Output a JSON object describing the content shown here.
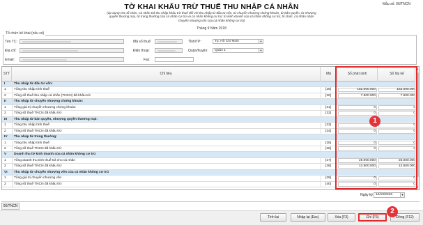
{
  "header": {
    "form_code": "Mẫu số: 06/TNCN",
    "title": "TỜ KHAI KHẤU TRỪ THUẾ THU NHẬP CÁ NHÂN",
    "subtitle": "(áp dụng cho tổ chức, cá nhân trả thu nhập khấu trừ thuế đối với thu nhập từ đầu tư vốn, từ chuyển nhượng chứng khoán, từ bản quyền, từ nhượng quyền thương mại, từ trúng thưởng của cá nhân cư trú và cá nhân không cư trú; từ kinh doanh của cá nhân không cư trú; tổ chức, cá nhân nhận chuyển nhượng vốn của cá nhân không cư trú)",
    "period": "Tháng 9 Năm 2018"
  },
  "org": {
    "section_label": "Tổ chức kê khai (nếu có)",
    "ten_tc_label": "Tên TC:",
    "ma_so_thue_label": "Mã số thuế:",
    "tinh_tp_label": "Tỉnh/TP:",
    "tinh_tp_value": "Tp. Hồ Chí Minh",
    "dia_chi_label": "Địa chỉ:",
    "dien_thoai_label": "Điện thoại:",
    "quan_huyen_label": "Quận/huyện:",
    "quan_huyen_value": "Quận 1",
    "email_label": "Email:",
    "fax_label": "Fax:"
  },
  "table": {
    "headers": {
      "stt": "STT",
      "chi_tieu": "Chỉ tiêu",
      "ma": "Mã",
      "so_phat_sinh": "Số phát sinh",
      "so_luy_ke": "Số lũy kế"
    },
    "rows": [
      {
        "type": "section",
        "stt": "I",
        "desc": "Thu nhập từ đầu tư vốn:"
      },
      {
        "type": "data",
        "stt": "1",
        "desc": "Tổng thu nhập tính thuế",
        "ma": "[29]",
        "v1": "152.000.000",
        "v2": "152.000.000"
      },
      {
        "type": "data",
        "stt": "2",
        "desc": "Tổng số thuế thu nhập cá nhân (TNCN) đã khấu trừ",
        "ma": "[30]",
        "v1": "7.600.000",
        "v2": "7.600.000"
      },
      {
        "type": "section",
        "stt": "II",
        "desc": "Thu nhập từ chuyển nhượng chứng khoán:"
      },
      {
        "type": "data",
        "stt": "1",
        "desc": "Tổng giá trị chuyển nhượng chứng khoán",
        "ma": "[31]",
        "v1": "0",
        "v2": "0"
      },
      {
        "type": "data",
        "stt": "2",
        "desc": "Tổng số thuế TNCN đã khấu trừ",
        "ma": "[32]",
        "v1": "0",
        "v2": "0"
      },
      {
        "type": "section",
        "stt": "III",
        "desc": "Thu nhập từ bản quyền, nhượng quyền thương mại:"
      },
      {
        "type": "data",
        "stt": "1",
        "desc": "Tổng thu nhập tính thuế",
        "ma": "[33]",
        "v1": "0",
        "v2": "0"
      },
      {
        "type": "data",
        "stt": "2",
        "desc": "Tổng số thuế TNCN đã khấu trừ",
        "ma": "[34]",
        "v1": "0",
        "v2": "0"
      },
      {
        "type": "section",
        "stt": "IV",
        "desc": "Thu nhập từ trúng thưởng:"
      },
      {
        "type": "data",
        "stt": "1",
        "desc": "Tổng thu nhập tính thuế",
        "ma": "[35]",
        "v1": "0",
        "v2": "0"
      },
      {
        "type": "data",
        "stt": "2",
        "desc": "Tổng số thuế TNCN đã khấu trừ",
        "ma": "[36]",
        "v1": "0",
        "v2": "0"
      },
      {
        "type": "section",
        "stt": "V",
        "desc": "Doanh thu từ kinh doanh của cá nhân không cư trú"
      },
      {
        "type": "data",
        "stt": "1",
        "desc": "Tổng doanh thu tính thuế trả cho cá nhân",
        "ma": "[37]",
        "v1": "25.000.000",
        "v2": "25.000.000"
      },
      {
        "type": "data",
        "stt": "2",
        "desc": "Tổng số thuế TNCN đã khấu trừ",
        "ma": "[38]",
        "v1": "12.500.000",
        "v2": "12.500.000"
      },
      {
        "type": "section",
        "stt": "VI",
        "desc": "Thu nhập từ chuyển nhượng vốn của cá nhân không cư trú"
      },
      {
        "type": "data",
        "stt": "1",
        "desc": "Tổng giá trị chuyển nhượng vốn",
        "ma": "[39]",
        "v1": "0",
        "v2": "0"
      },
      {
        "type": "data",
        "stt": "2",
        "desc": "Tổng số thuế TNCN đã khấu trừ",
        "ma": "[40]",
        "v1": "0",
        "v2": "0"
      }
    ]
  },
  "footer": {
    "ngay_ky_label": "Ngày ký",
    "ngay_ky_value": "12/10/2018",
    "tab_label": "06/TNCN",
    "buttons": {
      "tinh_lai": "Tính lại",
      "nhap_lai": "Nhập lại (Esc)",
      "xoa": "Xóa (F3)",
      "ghi": "Ghi (F5)",
      "dong": "Đóng (F12)"
    }
  },
  "annotations": {
    "badge_1": "1",
    "badge_2": "2"
  },
  "colors": {
    "highlight": "#e12b2b",
    "section_bg": "#d6e8f5",
    "badge": "#e3333b"
  }
}
